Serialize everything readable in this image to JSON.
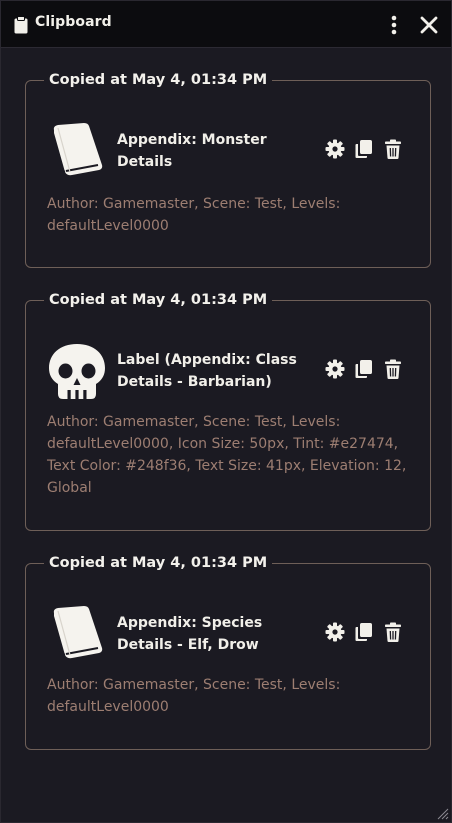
{
  "window": {
    "title": "Clipboard",
    "title_icon": "clipboard-icon",
    "menu_icon": "vertical-ellipsis-icon",
    "close_icon": "close-icon"
  },
  "colors": {
    "background": "#1b1a22",
    "titlebar": "#0c0c0f",
    "border": "#6e5f58",
    "meta_text": "#9d7e72",
    "text": "#f1efe9"
  },
  "entries": [
    {
      "copied_label": "Copied at May 4, 01:34 PM",
      "icon": "book-icon",
      "title": "Appendix: Monster Details",
      "meta": "Author: Gamemaster, Scene: Test, Levels: defaultLevel0000"
    },
    {
      "copied_label": "Copied at May 4, 01:34 PM",
      "icon": "skull-icon",
      "title": "Label (Appendix: Class Details - Barbarian)",
      "meta": "Author: Gamemaster, Scene: Test, Levels: defaultLevel0000, Icon Size: 50px, Tint: #e27474, Text Color: #248f36, Text Size: 41px, Elevation: 12, Global"
    },
    {
      "copied_label": "Copied at May 4, 01:34 PM",
      "icon": "book-icon",
      "title": "Appendix: Species Details - Elf, Drow",
      "meta": "Author: Gamemaster, Scene: Test, Levels: defaultLevel0000"
    }
  ],
  "actions": [
    "gear-icon",
    "copy-icon",
    "trash-icon"
  ]
}
